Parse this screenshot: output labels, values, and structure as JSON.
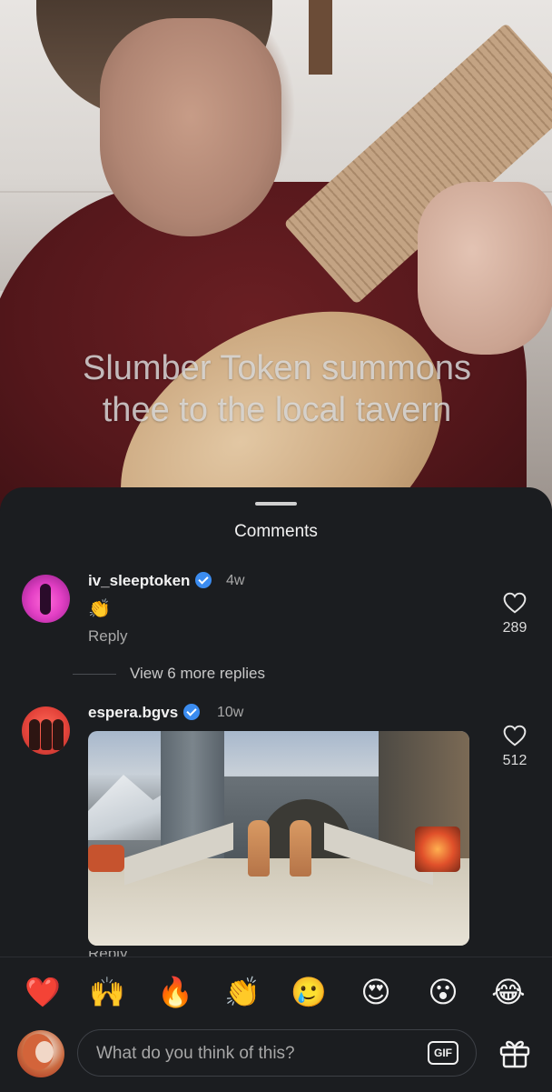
{
  "video": {
    "caption": "Slumber Token summons thee to the local tavern"
  },
  "comments_sheet": {
    "title": "Comments",
    "comments": [
      {
        "username": "iv_sleeptoken",
        "verified": true,
        "time": "4w",
        "text": "👏",
        "reply_label": "Reply",
        "likes": "289",
        "view_more": "View 6 more replies"
      },
      {
        "username": "espera.bgvs",
        "verified": true,
        "time": "10w",
        "attachment": "gif",
        "reply_label": "Reply",
        "likes": "512"
      }
    ]
  },
  "reactions": [
    "❤️",
    "🙌",
    "🔥",
    "👏",
    "🥲",
    "😍",
    "😮",
    "😂"
  ],
  "composer": {
    "placeholder": "What do you think of this?",
    "gif_label": "GIF"
  },
  "icons": {
    "like": "heart-outline-icon",
    "gift": "gift-icon",
    "verified": "verified-badge-icon"
  },
  "colors": {
    "sheet_bg": "#1b1d20",
    "verified": "#3b8cf0",
    "muted_text": "#a8a8a8"
  }
}
